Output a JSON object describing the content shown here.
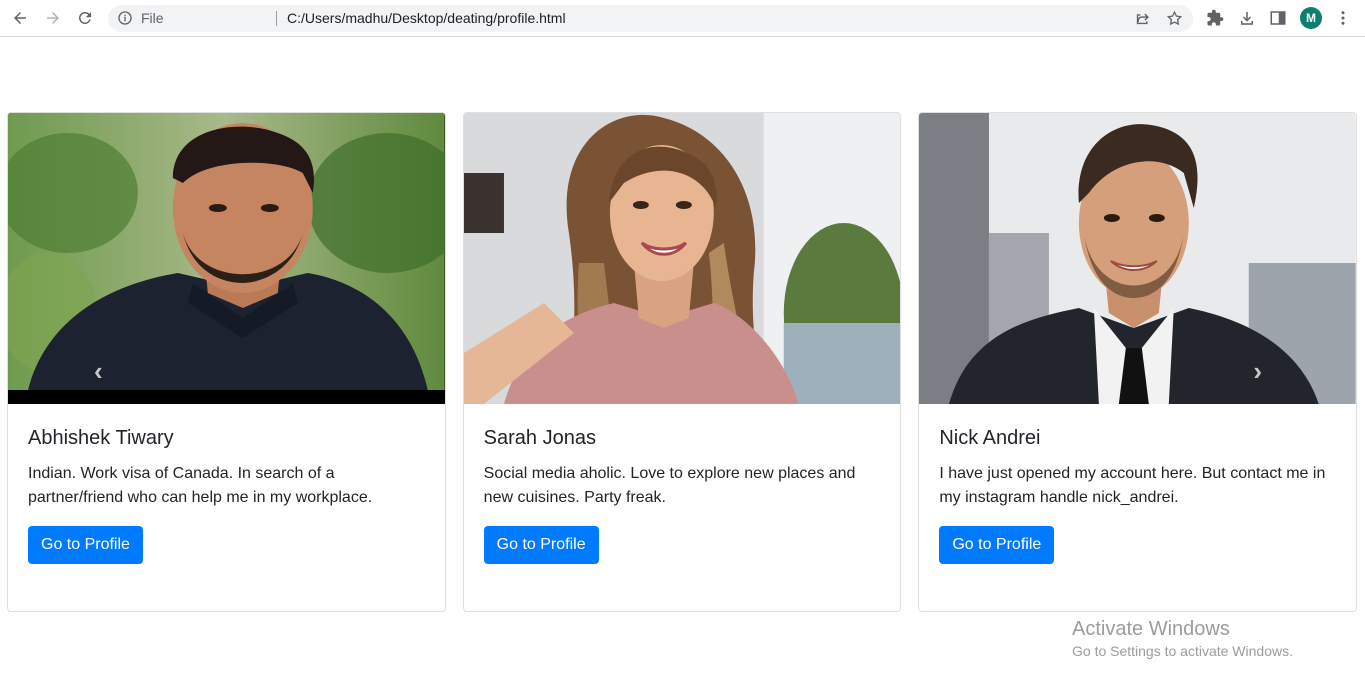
{
  "browser": {
    "file_label": "File",
    "url": "C:/Users/madhu/Desktop/deating/profile.html",
    "avatar_letter": "M",
    "avatar_color": "#0f7f6d"
  },
  "accent_color": "#007bff",
  "cards": [
    {
      "name": "Abhishek Tiwary",
      "description": "Indian. Work visa of Canada. In search of a partner/friend who can help me in my workplace.",
      "button": "Go to Profile",
      "prev_arrow": "‹"
    },
    {
      "name": "Sarah Jonas",
      "description": "Social media aholic. Love to explore new places and new cuisines. Party freak.",
      "button": "Go to Profile"
    },
    {
      "name": "Nick Andrei",
      "description": "I have just opened my account here. But contact me in my instagram handle nick_andrei.",
      "button": "Go to Profile",
      "next_arrow": "›"
    }
  ],
  "watermark": {
    "title": "Activate Windows",
    "subtitle": "Go to Settings to activate Windows."
  }
}
